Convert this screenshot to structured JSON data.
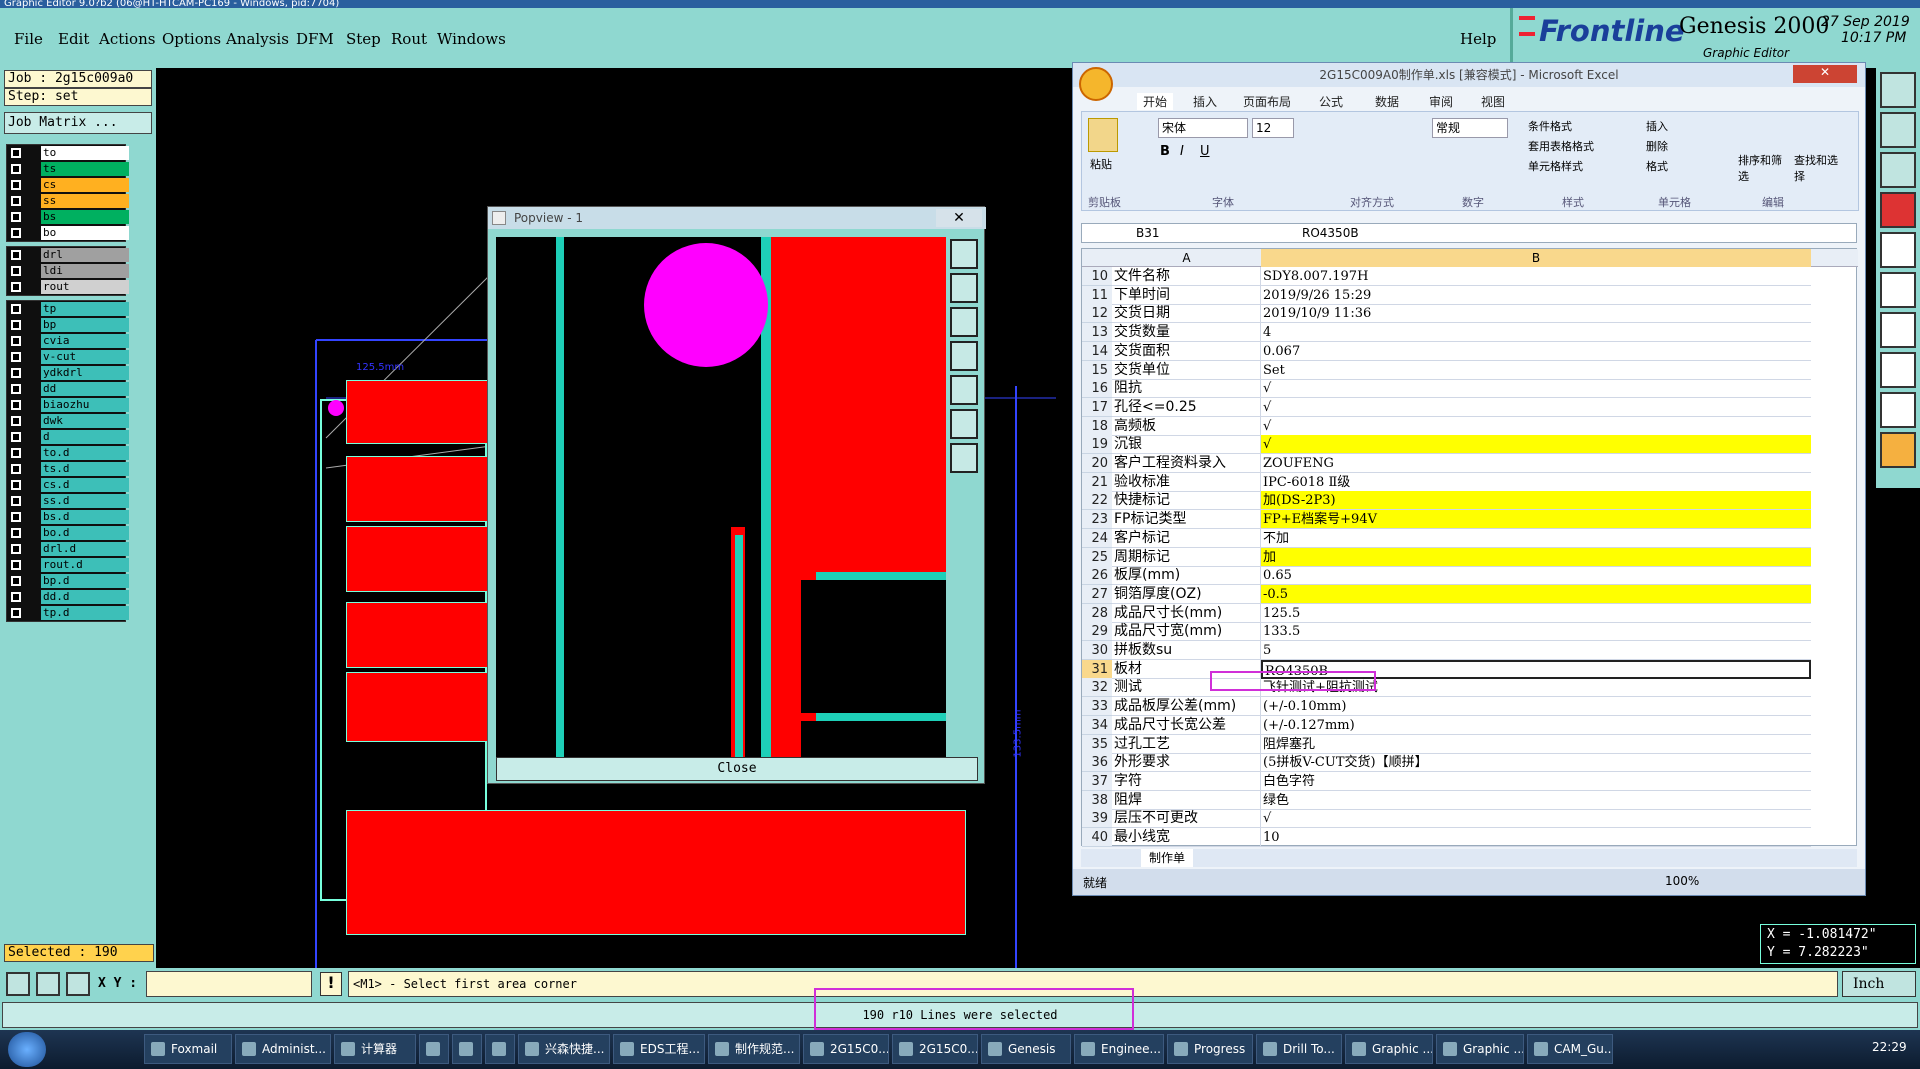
{
  "window_title": "Graphic Editor 9.0?b2 (06@HT-HTCAM-PC169 - Windows, pid:7704)",
  "menu": [
    "File",
    "Edit",
    "Actions",
    "Options",
    "Analysis",
    "DFM",
    "Step",
    "Rout",
    "Windows"
  ],
  "help": "Help",
  "logo": {
    "brand": "Frontline",
    "product": "Genesis 2000",
    "sub": "Graphic Editor",
    "date": "27 Sep 2019",
    "time": "10:17 PM"
  },
  "job": "Job : 2g15c009a0",
  "step": "Step: set",
  "job_matrix": "Job Matrix ...",
  "layers_a": [
    {
      "name": "to",
      "color": "#ffffff"
    },
    {
      "name": "ts",
      "color": "#00b060"
    },
    {
      "name": "cs",
      "color": "#ffb020"
    },
    {
      "name": "ss",
      "color": "#ffb020"
    },
    {
      "name": "bs",
      "color": "#00b060"
    },
    {
      "name": "bo",
      "color": "#ffffff"
    }
  ],
  "layers_b": [
    {
      "name": "drl",
      "color": "#a0a0a0"
    },
    {
      "name": "ldi",
      "color": "#a0a0a0"
    },
    {
      "name": "rout",
      "color": "#d0d0d0"
    }
  ],
  "layers_c": [
    "tp",
    "bp",
    "cvia",
    "v-cut",
    "ydkdrl",
    "dd",
    "biaozhu",
    "dwk",
    "d",
    "to.d",
    "ts.d",
    "cs.d",
    "ss.d",
    "bs.d",
    "bo.d",
    "drl.d",
    "rout.d",
    "bp.d",
    "dd.d",
    "tp.d"
  ],
  "layers_c_color": "#3dbfb8",
  "selected": "Selected : 190",
  "xy_label": "X Y :",
  "prompt": "<M1> - Select first area corner",
  "status_msg": "190 r10 Lines were selected",
  "units": "Inch",
  "coords": {
    "x": "X = -1.081472\"",
    "y": "Y = 7.282223\""
  },
  "canvas": {
    "dim_label": "133.5mm",
    "top_label": "125.5mm"
  },
  "popview": {
    "title": "Popview - 1",
    "close": "Close"
  },
  "excel": {
    "title": "2G15C009A0制作单.xls [兼容模式] - Microsoft Excel",
    "tabs": [
      "开始",
      "插入",
      "页面布局",
      "公式",
      "数据",
      "审阅",
      "视图"
    ],
    "groups": [
      "剪贴板",
      "字体",
      "对齐方式",
      "数字",
      "样式",
      "单元格",
      "编辑"
    ],
    "font": "宋体",
    "size": "12",
    "numfmt": "常规",
    "styles": [
      "条件格式",
      "套用表格格式",
      "单元格样式"
    ],
    "cells": [
      "插入",
      "删除",
      "格式"
    ],
    "edit": [
      "排序和筛选",
      "查找和选择"
    ],
    "paste": "粘贴",
    "namebox": "B31",
    "formula": "RO4350B",
    "col_a": "A",
    "col_b": "B",
    "rows": [
      {
        "n": "10",
        "a": "文件名称",
        "b": "SDY8.007.197H",
        "y": false
      },
      {
        "n": "11",
        "a": "下单时间",
        "b": "2019/9/26 15:29",
        "y": false
      },
      {
        "n": "12",
        "a": "交货日期",
        "b": "2019/10/9 11:36",
        "y": false
      },
      {
        "n": "13",
        "a": "交货数量",
        "b": "4",
        "y": false
      },
      {
        "n": "14",
        "a": "交货面积",
        "b": "0.067",
        "y": false
      },
      {
        "n": "15",
        "a": "交货单位",
        "b": "Set",
        "y": false
      },
      {
        "n": "16",
        "a": "阻抗",
        "b": "√",
        "y": false
      },
      {
        "n": "17",
        "a": "孔径<=0.25",
        "b": "√",
        "y": false
      },
      {
        "n": "18",
        "a": "高频板",
        "b": "√",
        "y": false
      },
      {
        "n": "19",
        "a": "沉银",
        "b": "√",
        "y": true
      },
      {
        "n": "20",
        "a": "客户工程资料录入",
        "b": "ZOUFENG",
        "y": false
      },
      {
        "n": "21",
        "a": "验收标准",
        "b": "IPC-6018 Ⅱ级",
        "y": false
      },
      {
        "n": "22",
        "a": "快捷标记",
        "b": "加(DS-2P3)",
        "y": true
      },
      {
        "n": "23",
        "a": "FP标记类型",
        "b": "FP+E档案号+94V",
        "y": true
      },
      {
        "n": "24",
        "a": "客户标记",
        "b": "不加",
        "y": false
      },
      {
        "n": "25",
        "a": "周期标记",
        "b": "加",
        "y": true
      },
      {
        "n": "26",
        "a": "板厚(mm)",
        "b": "0.65",
        "y": false
      },
      {
        "n": "27",
        "a": "铜箔厚度(OZ)",
        "b": "-0.5",
        "y": true
      },
      {
        "n": "28",
        "a": "成品尺寸长(mm)",
        "b": "125.5",
        "y": false
      },
      {
        "n": "29",
        "a": "成品尺寸宽(mm)",
        "b": "133.5",
        "y": false
      },
      {
        "n": "30",
        "a": "拼板数su",
        "b": "5",
        "y": false
      },
      {
        "n": "31",
        "a": "板材",
        "b": "RO4350B",
        "y": false
      },
      {
        "n": "32",
        "a": "测试",
        "b": "飞针测试+阻抗测试",
        "y": false
      },
      {
        "n": "33",
        "a": "成品板厚公差(mm)",
        "b": "(+/-0.10mm)",
        "y": false
      },
      {
        "n": "34",
        "a": "成品尺寸长宽公差",
        "b": "(+/-0.127mm)",
        "y": false
      },
      {
        "n": "35",
        "a": "过孔工艺",
        "b": "阻焊塞孔",
        "y": false
      },
      {
        "n": "36",
        "a": "外形要求",
        "b": "(5拼板V-CUT交货)【顺拼】",
        "y": false
      },
      {
        "n": "37",
        "a": "字符",
        "b": "白色字符",
        "y": false
      },
      {
        "n": "38",
        "a": "阻焊",
        "b": "绿色",
        "y": false
      },
      {
        "n": "39",
        "a": "层压不可更改",
        "b": "√",
        "y": false
      },
      {
        "n": "40",
        "a": "最小线宽",
        "b": "10",
        "y": false
      }
    ],
    "sheet_tab": "制作单",
    "status": "就绪",
    "zoom": "100%"
  },
  "taskbar": {
    "items": [
      "Foxmail",
      "Administ...",
      "计算器",
      "",
      "",
      "",
      "兴森快捷...",
      "EDS工程...",
      "制作规范...",
      "2G15C0...",
      "2G15C0...",
      "Genesis",
      "Enginee...",
      "Progress",
      "Drill To...",
      "Graphic ...",
      "Graphic ...",
      "CAM_Gu..."
    ],
    "clock": "22:29"
  }
}
